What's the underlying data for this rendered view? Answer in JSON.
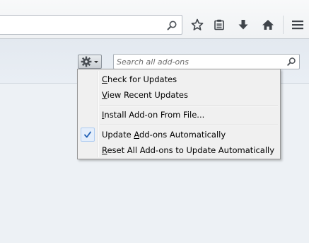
{
  "toolbar": {
    "icons": {
      "url_search": "search-icon",
      "bookmark": "star-icon",
      "reading_list": "clipboard-icon",
      "downloads": "download-arrow-icon",
      "home": "home-icon",
      "menu": "hamburger-menu-icon"
    }
  },
  "addons": {
    "gear_icon": "gear-icon",
    "search": {
      "placeholder": "Search all add-ons",
      "value": "",
      "icon": "search-icon"
    }
  },
  "menu": {
    "items": [
      {
        "label": "Check for Updates",
        "access_key": "C",
        "checked": false
      },
      {
        "label": "View Recent Updates",
        "access_key": "V",
        "checked": false
      },
      {
        "label": "Install Add-on From File...",
        "access_key": "I",
        "checked": false
      },
      {
        "label": "Update Add-ons Automatically",
        "access_key": "A",
        "checked": true
      },
      {
        "label": "Reset All Add-ons to Update Automatically",
        "access_key": "R",
        "checked": false
      }
    ]
  },
  "colors": {
    "accent_check": "#1f5fb4",
    "menu_background": "#f0f0f0",
    "content_background": "#e9eef4"
  }
}
